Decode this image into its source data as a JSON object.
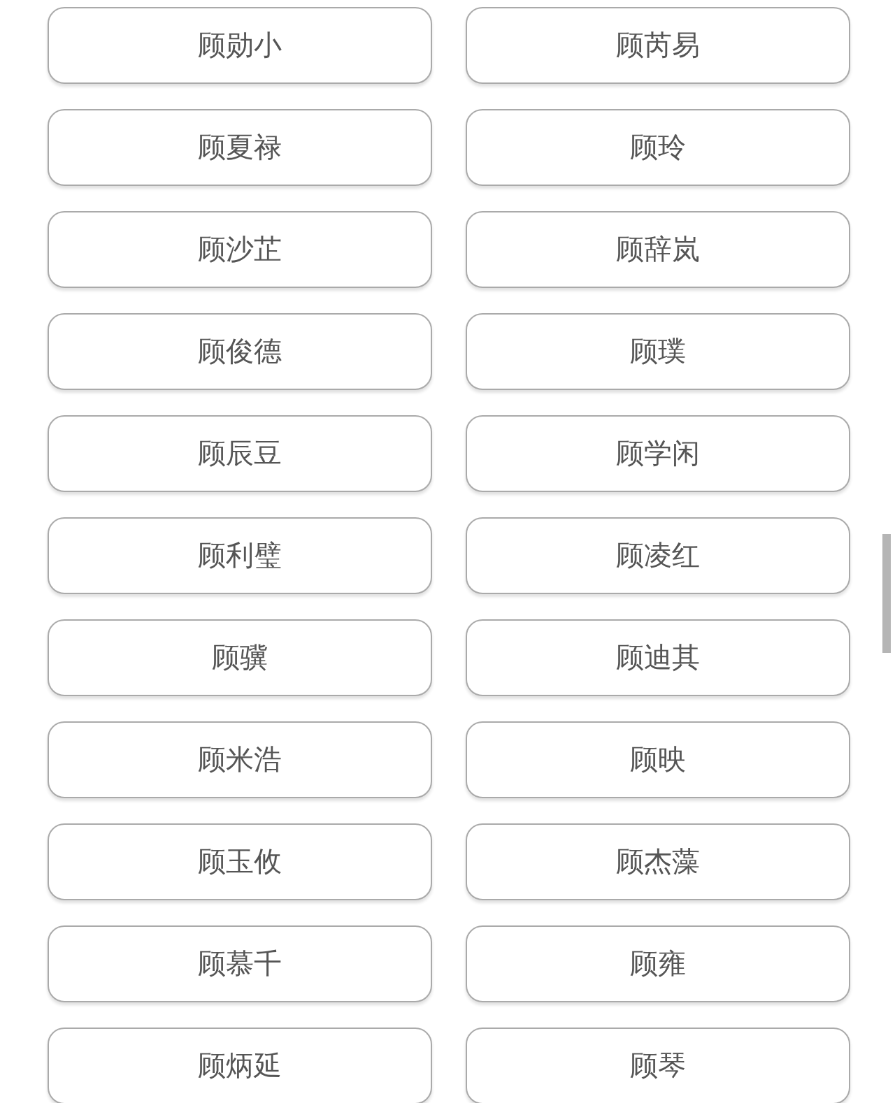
{
  "names": [
    {
      "label": "顾勋小"
    },
    {
      "label": "顾芮易"
    },
    {
      "label": "顾夏禄"
    },
    {
      "label": "顾玲"
    },
    {
      "label": "顾沙芷"
    },
    {
      "label": "顾辞岚"
    },
    {
      "label": "顾俊德"
    },
    {
      "label": "顾璞"
    },
    {
      "label": "顾辰豆"
    },
    {
      "label": "顾学闲"
    },
    {
      "label": "顾利璧"
    },
    {
      "label": "顾凌红"
    },
    {
      "label": "顾骥"
    },
    {
      "label": "顾迪其"
    },
    {
      "label": "顾米浩"
    },
    {
      "label": "顾映"
    },
    {
      "label": "顾玉攸"
    },
    {
      "label": "顾杰藻"
    },
    {
      "label": "顾慕千"
    },
    {
      "label": "顾雍"
    },
    {
      "label": "顾炳延"
    },
    {
      "label": "顾琴"
    }
  ]
}
